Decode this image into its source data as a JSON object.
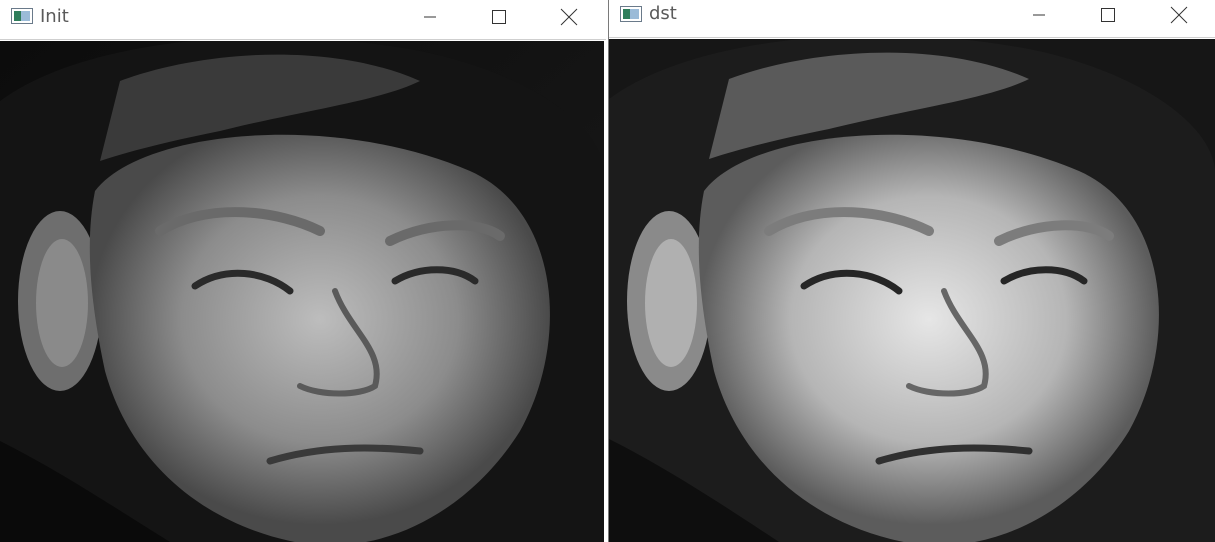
{
  "windows": [
    {
      "title": "Init"
    },
    {
      "title": "dst"
    }
  ],
  "colors": {
    "titlebar": "#ffffff",
    "title_text": "#5a5a5a",
    "canvas_bg": "#000000"
  }
}
